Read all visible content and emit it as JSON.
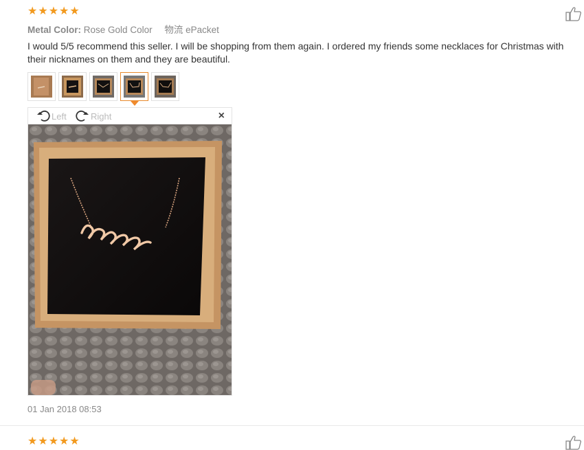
{
  "reviews": [
    {
      "rating": 5,
      "metal_label": "Metal Color:",
      "metal_value": "Rose Gold Color",
      "shipping_label": "物流",
      "shipping_value": "ePacket",
      "text": "I would 5/5 recommend this seller. I will be shopping from them again. I ordered my friends some necklaces for Christmas with their nicknames on them and they are beautiful.",
      "thumbnails": 5,
      "active_thumbnail": 4,
      "viewer": {
        "rotate_left": "Left",
        "rotate_right": "Right",
        "close": "×"
      },
      "date": "01 Jan 2018 08:53"
    },
    {
      "rating": 5
    }
  ],
  "icons": {
    "star": "star-icon",
    "like": "thumbs-up-icon",
    "rotate_left": "rotate-left-icon",
    "rotate_right": "rotate-right-icon",
    "close": "close-icon"
  },
  "colors": {
    "star": "#f29a1f",
    "active_border": "#e8892b",
    "meta": "#888888"
  }
}
